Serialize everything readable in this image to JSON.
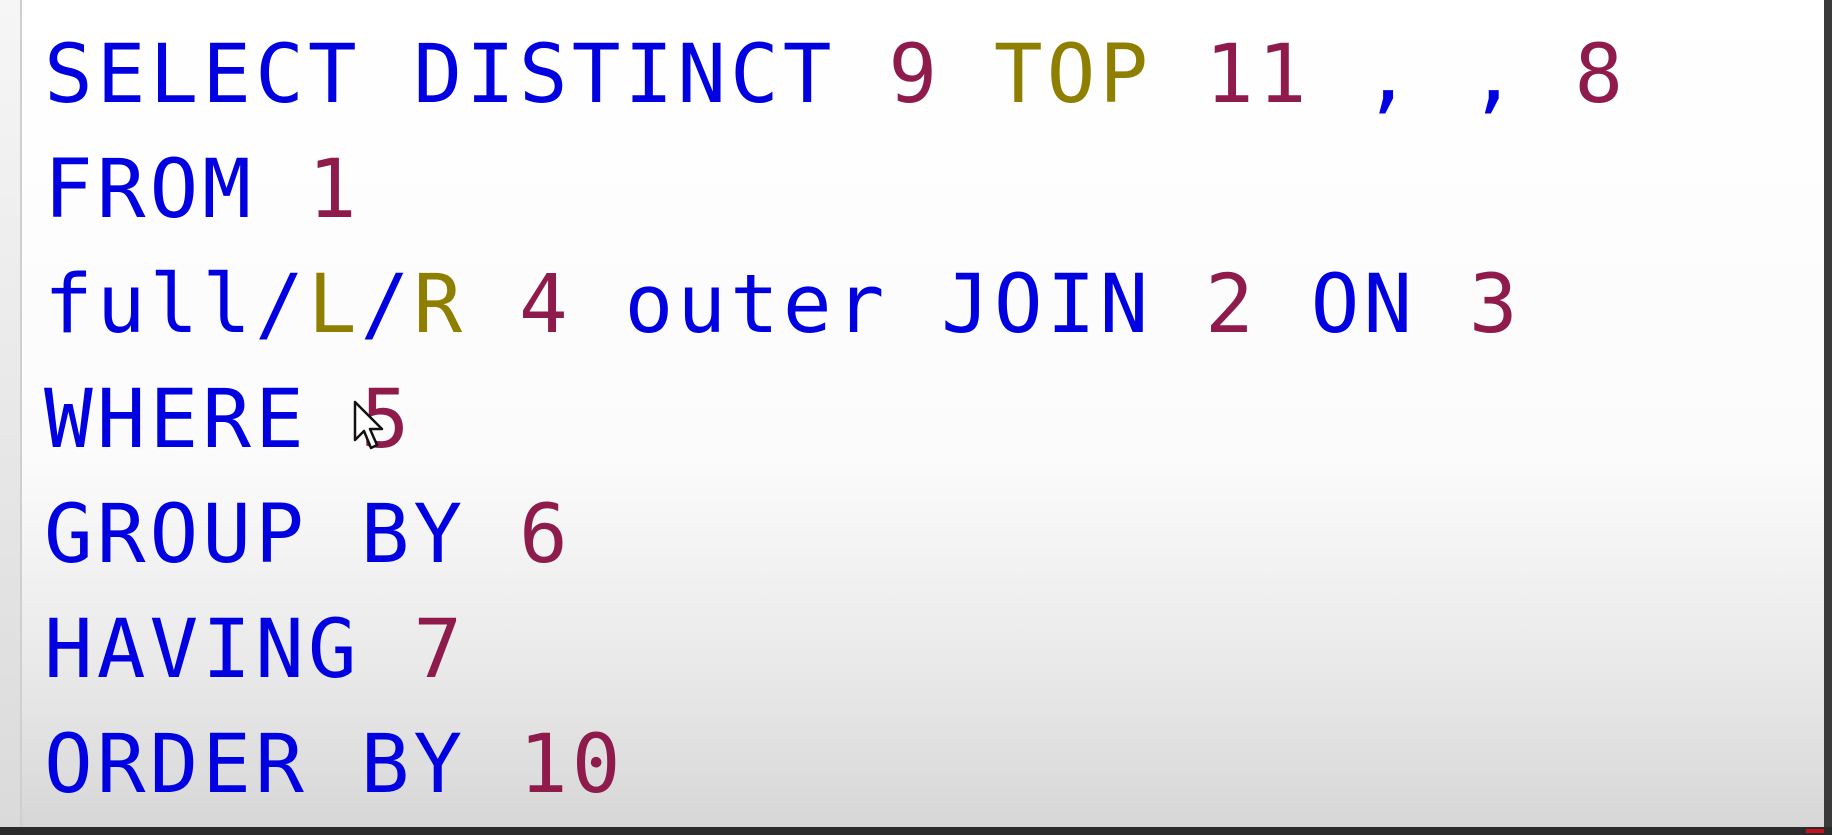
{
  "editor": {
    "lines": [
      {
        "tokens": [
          {
            "text": "SELECT",
            "kind": "keyword"
          },
          {
            "text": " ",
            "kind": "space"
          },
          {
            "text": "DISTINCT",
            "kind": "keyword"
          },
          {
            "text": " ",
            "kind": "space"
          },
          {
            "text": "9",
            "kind": "number"
          },
          {
            "text": " ",
            "kind": "space"
          },
          {
            "text": "TOP",
            "kind": "alt"
          },
          {
            "text": " ",
            "kind": "space"
          },
          {
            "text": "11",
            "kind": "number"
          },
          {
            "text": " ",
            "kind": "space"
          },
          {
            "text": ",",
            "kind": "symbol"
          },
          {
            "text": " ",
            "kind": "space"
          },
          {
            "text": ",",
            "kind": "symbol"
          },
          {
            "text": " ",
            "kind": "space"
          },
          {
            "text": "8",
            "kind": "number"
          }
        ]
      },
      {
        "tokens": [
          {
            "text": "FROM",
            "kind": "keyword"
          },
          {
            "text": " ",
            "kind": "space"
          },
          {
            "text": "1",
            "kind": "number"
          }
        ]
      },
      {
        "tokens": [
          {
            "text": "full/",
            "kind": "keyword"
          },
          {
            "text": "L",
            "kind": "alt"
          },
          {
            "text": "/",
            "kind": "keyword"
          },
          {
            "text": "R",
            "kind": "alt"
          },
          {
            "text": " ",
            "kind": "space"
          },
          {
            "text": "4",
            "kind": "number"
          },
          {
            "text": " ",
            "kind": "space"
          },
          {
            "text": "outer",
            "kind": "keyword"
          },
          {
            "text": " ",
            "kind": "space"
          },
          {
            "text": "JOIN",
            "kind": "keyword"
          },
          {
            "text": " ",
            "kind": "space"
          },
          {
            "text": "2",
            "kind": "number"
          },
          {
            "text": " ",
            "kind": "space"
          },
          {
            "text": "ON",
            "kind": "keyword"
          },
          {
            "text": " ",
            "kind": "space"
          },
          {
            "text": "3",
            "kind": "number"
          }
        ]
      },
      {
        "tokens": [
          {
            "text": "WHERE",
            "kind": "keyword"
          },
          {
            "text": " ",
            "kind": "space"
          },
          {
            "text": "5",
            "kind": "number"
          }
        ]
      },
      {
        "tokens": [
          {
            "text": "GROUP",
            "kind": "keyword"
          },
          {
            "text": " ",
            "kind": "space"
          },
          {
            "text": "BY",
            "kind": "keyword"
          },
          {
            "text": " ",
            "kind": "space"
          },
          {
            "text": "6",
            "kind": "number"
          }
        ]
      },
      {
        "tokens": [
          {
            "text": "HAVING",
            "kind": "keyword"
          },
          {
            "text": " ",
            "kind": "space"
          },
          {
            "text": "7",
            "kind": "number"
          }
        ]
      },
      {
        "tokens": [
          {
            "text": "ORDER",
            "kind": "keyword"
          },
          {
            "text": " ",
            "kind": "space"
          },
          {
            "text": "BY",
            "kind": "keyword"
          },
          {
            "text": " ",
            "kind": "space"
          },
          {
            "text": "10",
            "kind": "number"
          }
        ]
      }
    ]
  },
  "colors": {
    "keyword": "#0000e0",
    "number": "#8e1b4b",
    "alt": "#8f7f00",
    "background": "#ffffff"
  },
  "icons": {
    "cursor": "mouse-pointer-icon"
  }
}
